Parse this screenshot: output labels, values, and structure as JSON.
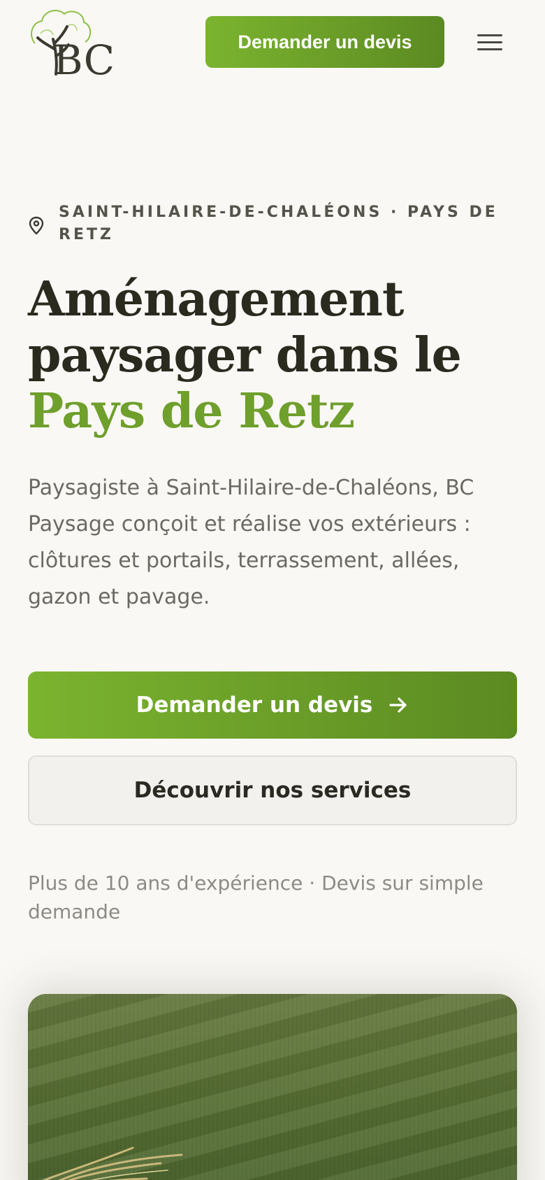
{
  "header": {
    "logo_text": "BC",
    "cta_label": "Demander un devis",
    "menu_icon": "hamburger-icon"
  },
  "hero": {
    "kicker_icon": "map-pin-icon",
    "kicker": "SAINT-HILAIRE-DE-CHALÉONS · PAYS DE RETZ",
    "title_line1": "Aménagement",
    "title_line2": "paysager dans le",
    "title_accent": "Pays de Retz",
    "lead": "Paysagiste à Saint-Hilaire-de-Chaléons, BC Paysage conçoit et réalise vos extérieurs : clôtures et portails, terrassement, allées, gazon et pavage.",
    "primary_cta": "Demander un devis",
    "primary_cta_icon": "arrow-right-icon",
    "secondary_cta": "Découvrir nos services",
    "proof": "Plus de 10 ans d'expérience · Devis sur simple demande"
  },
  "colors": {
    "accent": "#6f9f2c",
    "button_gradient_start": "#7bb42f",
    "button_gradient_end": "#5b8a22",
    "background": "#faf8f5"
  }
}
